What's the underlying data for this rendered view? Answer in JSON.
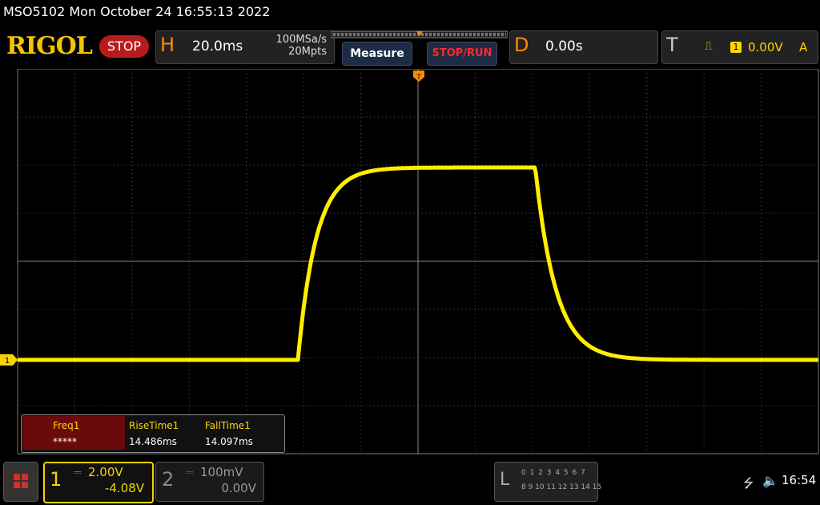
{
  "title": "MSO5102  Mon October 24 16:55:13 2022",
  "brand": "RIGOL",
  "run_state": "STOP",
  "horizontal": {
    "letter": "H",
    "timebase": "20.0ms",
    "sample_rate": "100MSa/s",
    "memory_depth": "20Mpts"
  },
  "buttons": {
    "measure": "Measure",
    "stop_run": "STOP/RUN"
  },
  "delay": {
    "letter": "D",
    "value": "0.00s"
  },
  "trigger": {
    "letter": "T",
    "edge_icon": "rising-edge-icon",
    "edge_glyph": "⎍",
    "source": "1",
    "level": "0.00V",
    "mode": "A"
  },
  "channel1": {
    "number": "1",
    "coupling": "⎓",
    "scale": "2.00V",
    "offset": "-4.08V",
    "color": "#f5d400",
    "marker": "1"
  },
  "channel2": {
    "number": "2",
    "coupling": "⎓",
    "scale": "100mV",
    "offset": "0.00V"
  },
  "measurements": [
    {
      "name": "Freq1",
      "value": "*****"
    },
    {
      "name": "RiseTime1",
      "value": "14.486ms"
    },
    {
      "name": "FallTime1",
      "value": "14.097ms"
    }
  ],
  "logic": {
    "letter": "L",
    "row1": "0 1 2 3  4 5 6 7",
    "row2": "8 9 10 11 12 13 14 15"
  },
  "status": {
    "clock": "16:54"
  },
  "colors": {
    "trace": "#ffee00",
    "accent": "#ff8a00",
    "grid": "#555555"
  },
  "waveform": {
    "low_level_div": -2.05,
    "high_level_div": 1.95,
    "rise_start_time_div": -2.1,
    "fall_start_time_div": 2.05
  }
}
